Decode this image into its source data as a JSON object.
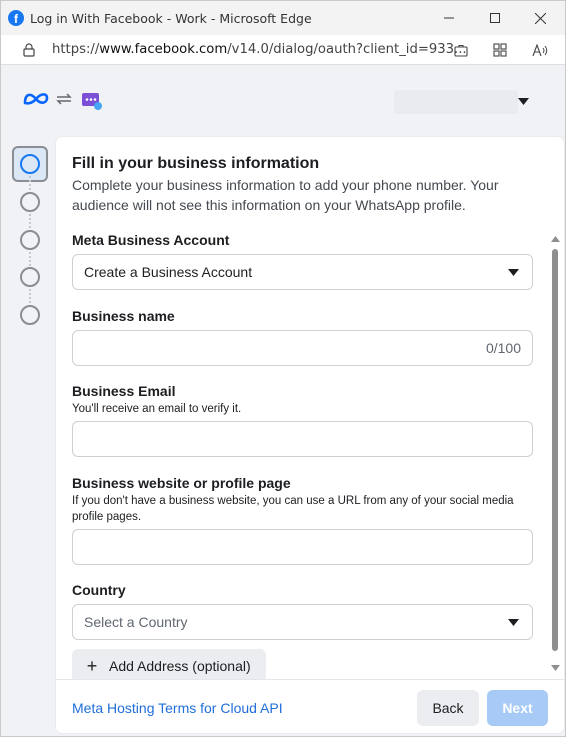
{
  "window": {
    "title": "Log in With Facebook - Work - Microsoft Edge",
    "url_prefix": "https://",
    "url_domain": "www.facebook.com",
    "url_rest": "/v14.0/dialog/oauth?client_id=933..."
  },
  "icons": {
    "app": "facebook-icon",
    "lock": "lock-icon",
    "meta": "meta-logo",
    "swap": "swap-arrows-icon",
    "whatsapp_app": "app-chat-icon"
  },
  "form": {
    "title": "Fill in your business information",
    "subtitle": "Complete your business information to add your phone number. Your audience will not see this information on your WhatsApp profile.",
    "meta_business_account": {
      "label": "Meta Business Account",
      "value": "Create a Business Account"
    },
    "business_name": {
      "label": "Business name",
      "value": "",
      "counter": "0/100"
    },
    "business_email": {
      "label": "Business Email",
      "hint": "You'll receive an email to verify it.",
      "value": ""
    },
    "business_website": {
      "label": "Business website or profile page",
      "hint": "If you don't have a business website, you can use a URL from any of your social media profile pages.",
      "value": ""
    },
    "country": {
      "label": "Country",
      "placeholder": "Select a Country"
    },
    "add_address_label": "Add Address (optional)"
  },
  "footer": {
    "terms_link": "Meta Hosting Terms for Cloud API",
    "back_label": "Back",
    "next_label": "Next"
  },
  "colors": {
    "brand_blue": "#1877f2",
    "link_blue": "#216fdb",
    "next_disabled": "#a7caf6"
  }
}
